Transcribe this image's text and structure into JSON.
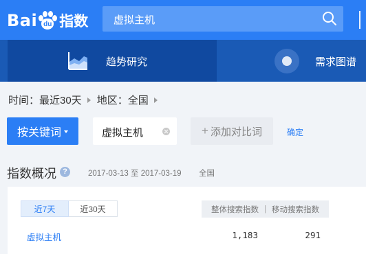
{
  "header": {
    "logo_left": "Bai",
    "logo_paw_text": "du",
    "logo_sub": "指数",
    "search_value": "虚拟主机"
  },
  "nav": {
    "tabs": [
      {
        "label": "趋势研究",
        "icon": "trend-chart-icon",
        "active": true
      },
      {
        "label": "需求图谱",
        "icon": "demand-graph-icon",
        "active": false
      }
    ]
  },
  "filter": {
    "time_label": "时间：最近30天",
    "region_label": "地区：全国"
  },
  "keywords": {
    "button_label": "按关键词",
    "current_keyword": "虚拟主机",
    "add_compare_label": "添加对比词",
    "confirm_label": "确定"
  },
  "overview": {
    "title": "指数概况",
    "date_range": "2017-03-13 至 2017-03-19",
    "region": "全国",
    "range_tabs": [
      "近7天",
      "近30天"
    ],
    "active_range": "近7天",
    "columns": [
      "整体搜索指数",
      "移动搜索指数"
    ],
    "column_separator": "|",
    "rows": [
      {
        "keyword": "虚拟主机",
        "overall": "1,183",
        "mobile": "291"
      }
    ]
  },
  "colors": {
    "header_bg": "#2b7ef5",
    "nav_bg": "#1a5ab5",
    "nav_active_bg": "#1049a0",
    "accent": "#2b7ef5",
    "page_bg": "#f1f4f8"
  }
}
